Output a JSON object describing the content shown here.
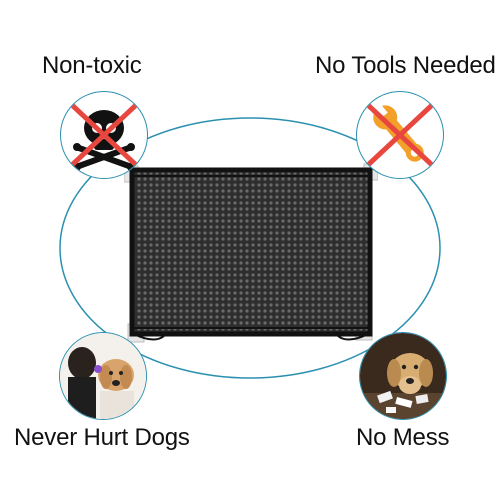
{
  "features": {
    "top_left": {
      "label": "Non-toxic",
      "icon": "crossed-skull-icon"
    },
    "top_right": {
      "label": "No Tools Needed",
      "icon": "crossed-wrench-icon"
    },
    "bottom_left": {
      "label": "Never Hurt Dogs",
      "icon": "dog-with-child-photo"
    },
    "bottom_right": {
      "label": "No Mess",
      "icon": "dog-no-mess-photo"
    }
  },
  "product": {
    "icon": "mesh-dog-gate"
  },
  "colors": {
    "ring": "#2b90b0",
    "cross": "#e8473f",
    "wrench": "#f2a02a",
    "mesh": "#1a1a1a",
    "text": "#111111"
  }
}
